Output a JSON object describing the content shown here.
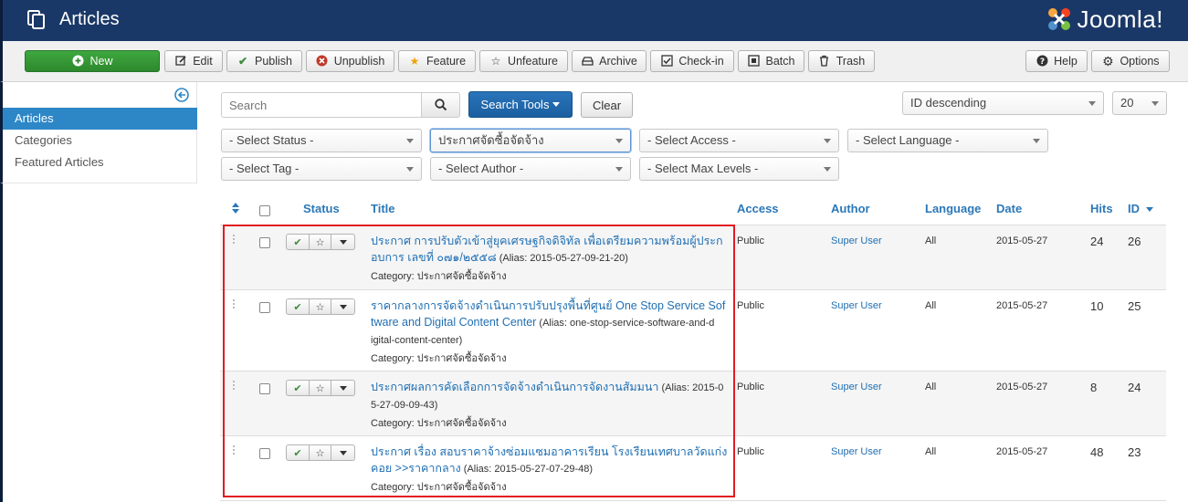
{
  "header": {
    "title": "Articles",
    "logo_text": "Joomla!"
  },
  "toolbar": {
    "new": "New",
    "edit": "Edit",
    "publish": "Publish",
    "unpublish": "Unpublish",
    "feature": "Feature",
    "unfeature": "Unfeature",
    "archive": "Archive",
    "checkin": "Check-in",
    "batch": "Batch",
    "trash": "Trash",
    "help": "Help",
    "options": "Options"
  },
  "sidebar": {
    "items": [
      {
        "label": "Articles",
        "active": true
      },
      {
        "label": "Categories",
        "active": false
      },
      {
        "label": "Featured Articles",
        "active": false
      }
    ]
  },
  "filters": {
    "search_placeholder": "Search",
    "search_tools": "Search Tools",
    "clear": "Clear",
    "ordering": "ID descending",
    "limit": "20",
    "status": "- Select Status -",
    "category": "ประกาศจัดซื้อจัดจ้าง",
    "access": "- Select Access -",
    "language": "- Select Language -",
    "tag": "- Select Tag -",
    "author": "- Select Author -",
    "max_levels": "- Select Max Levels -"
  },
  "table": {
    "headers": {
      "status": "Status",
      "title": "Title",
      "access": "Access",
      "author": "Author",
      "language": "Language",
      "date": "Date",
      "hits": "Hits",
      "id": "ID"
    },
    "rows": [
      {
        "title_line1": "ประกาศ การปรับตัวเข้าสู่ยุคเศรษฐกิจดิจิทัล เพื่อเตรียมความพร้อมผู้ประก",
        "title_line2": "อบการ เลขที่ ๐๗๑/๒๕๕๘",
        "alias_line2": " (Alias: 2015-05-27-09-21-20)",
        "alias_line3": "",
        "category": "Category: ประกาศจัดซื้อจัดจ้าง",
        "access": "Public",
        "author": "Super User",
        "language": "All",
        "date": "2015-05-27",
        "hits": "24",
        "id": "26"
      },
      {
        "title_line1": "ราคากลางการจัดจ้างดำเนินการปรับปรุงพื้นที่ศูนย์ One Stop Service Sof",
        "title_line2": "tware and Digital Content Center",
        "alias_line2": " (Alias: one-stop-service-software-and-d",
        "alias_line3": "igital-content-center)",
        "category": "Category: ประกาศจัดซื้อจัดจ้าง",
        "access": "Public",
        "author": "Super User",
        "language": "All",
        "date": "2015-05-27",
        "hits": "10",
        "id": "25"
      },
      {
        "title_line1": "ประกาศผลการคัดเลือกการจัดจ้างดำเนินการจัดงานสัมมนา",
        "title_line2": "",
        "alias_line1": " (Alias: 2015-0",
        "alias_line2": "5-27-09-09-43)",
        "alias_line3": "",
        "category": "Category: ประกาศจัดซื้อจัดจ้าง",
        "access": "Public",
        "author": "Super User",
        "language": "All",
        "date": "2015-05-27",
        "hits": "8",
        "id": "24"
      },
      {
        "title_line1": "ประกาศ เรื่อง สอบราคาจ้างซ่อมแซมอาคารเรียน โรงเรียนเทศบาลวัดแก่ง",
        "title_line2": "คอย >>ราคากลาง",
        "alias_line2": " (Alias: 2015-05-27-07-29-48)",
        "alias_line3": "",
        "category": "Category: ประกาศจัดซื้อจัดจ้าง",
        "access": "Public",
        "author": "Super User",
        "language": "All",
        "date": "2015-05-27",
        "hits": "48",
        "id": "23"
      }
    ]
  },
  "colors": {
    "header_bg": "#1a3867",
    "new_button": "#2f8a2f",
    "primary_blue": "#1f6fb3",
    "highlight_box": "#e11b22"
  }
}
